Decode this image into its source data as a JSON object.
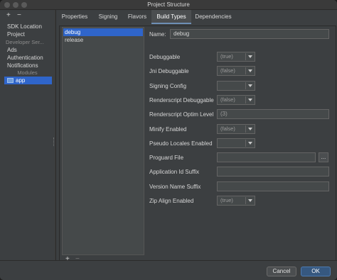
{
  "window": {
    "title": "Project Structure"
  },
  "sidebar": {
    "add_label": "+",
    "remove_label": "−",
    "items": [
      {
        "label": "SDK Location"
      },
      {
        "label": "Project"
      }
    ],
    "developer_header": "Developer Ser...",
    "dev_items": [
      {
        "label": "Ads"
      },
      {
        "label": "Authentication"
      },
      {
        "label": "Notifications"
      }
    ],
    "modules_header": "Modules",
    "module": {
      "label": "app"
    }
  },
  "tabs": [
    {
      "label": "Properties"
    },
    {
      "label": "Signing"
    },
    {
      "label": "Flavors"
    },
    {
      "label": "Build Types"
    },
    {
      "label": "Dependencies"
    }
  ],
  "build_types": {
    "items": [
      {
        "label": "debug"
      },
      {
        "label": "release"
      }
    ],
    "add_label": "+",
    "remove_label": "−"
  },
  "form": {
    "name_label": "Name:",
    "name_value": "debug",
    "debuggable": {
      "label": "Debuggable",
      "value": "(true)"
    },
    "jni": {
      "label": "Jni Debuggable",
      "value": "(false)"
    },
    "signing": {
      "label": "Signing Config",
      "value": ""
    },
    "renderscript": {
      "label": "Renderscript Debuggable",
      "value": "(false)"
    },
    "renderscript_optim": {
      "label": "Renderscript Optim Level",
      "value": "(3)"
    },
    "minify": {
      "label": "Minify Enabled",
      "value": "(false)"
    },
    "pseudo": {
      "label": "Pseudo Locales Enabled",
      "value": ""
    },
    "proguard": {
      "label": "Proguard File",
      "value": "",
      "browse_label": "..."
    },
    "app_id_suffix": {
      "label": "Application Id Suffix",
      "value": ""
    },
    "version_suffix": {
      "label": "Version Name Suffix",
      "value": ""
    },
    "zip_align": {
      "label": "Zip Align Enabled",
      "value": "(true)"
    }
  },
  "buttons": {
    "cancel": "Cancel",
    "ok": "OK"
  }
}
